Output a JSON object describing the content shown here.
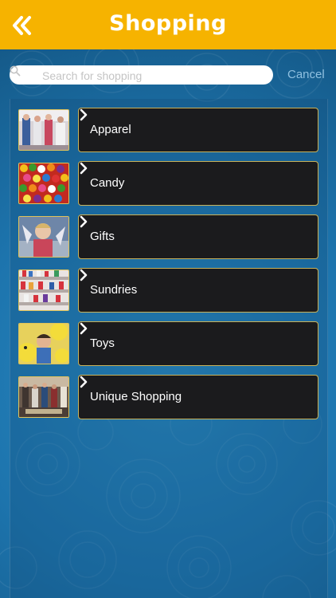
{
  "header": {
    "title": "Shopping",
    "back_icon": "double-chevron-left-icon"
  },
  "search": {
    "placeholder": "Search for shopping",
    "value": "",
    "cancel_label": "Cancel"
  },
  "colors": {
    "header": "#f6b300",
    "background": "#1b6fa6",
    "card": "#1b1b1d",
    "card_border": "#c9b25a"
  },
  "categories": [
    {
      "label": "Apparel",
      "thumb": "apparel-photo"
    },
    {
      "label": "Candy",
      "thumb": "candy-photo"
    },
    {
      "label": "Gifts",
      "thumb": "gifts-photo"
    },
    {
      "label": "Sundries",
      "thumb": "sundries-photo"
    },
    {
      "label": "Toys",
      "thumb": "toys-photo"
    },
    {
      "label": "Unique Shopping",
      "thumb": "unique-shopping-photo"
    }
  ]
}
